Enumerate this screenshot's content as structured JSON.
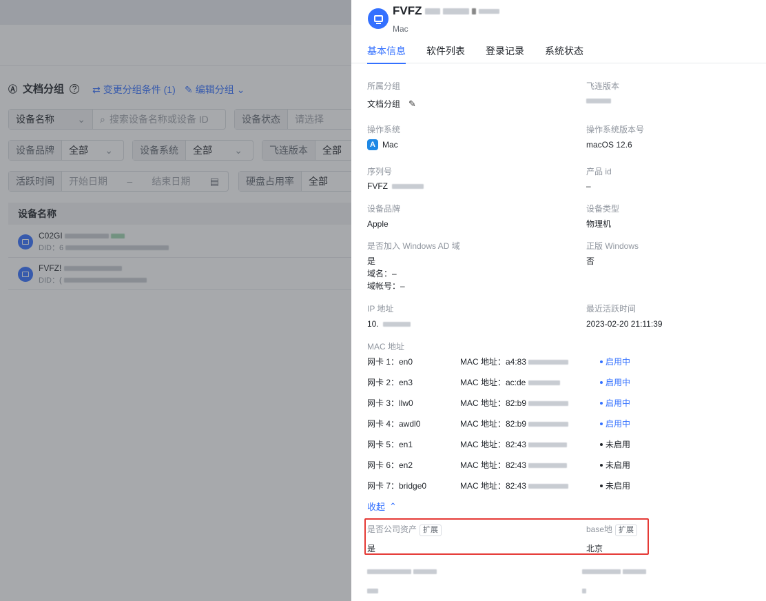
{
  "background": {
    "group": {
      "title": "文档分组",
      "change_condition": "变更分组条件 (1)",
      "edit_group": "编辑分组"
    },
    "filters": {
      "device_name_label": "设备名称",
      "search_placeholder": "搜索设备名称或设备 ID",
      "device_status_label": "设备状态",
      "device_status_placeholder": "请选择",
      "device_brand_label": "设备品牌",
      "device_brand_value": "全部",
      "device_system_label": "设备系统",
      "device_system_value": "全部",
      "feilian_version_label": "飞连版本",
      "feilian_version_value": "全部",
      "active_time_label": "活跃时间",
      "start_date_placeholder": "开始日期",
      "date_separator": "–",
      "end_date_placeholder": "结束日期",
      "disk_usage_label": "硬盘占用率",
      "disk_usage_value": "全部"
    },
    "table": {
      "header": "设备名称",
      "rows": [
        {
          "name": "C02GI",
          "did": "DID：6"
        },
        {
          "name": "FVFZ!",
          "did": "DID：("
        }
      ]
    }
  },
  "drawer": {
    "title": "FVFZ",
    "subtitle": "Mac",
    "tabs": [
      "基本信息",
      "软件列表",
      "登录记录",
      "系统状态"
    ],
    "fields": {
      "group_label": "所属分组",
      "group_value": "文档分组",
      "version_label": "飞连版本",
      "os_label": "操作系统",
      "os_value": "Mac",
      "os_version_label": "操作系统版本号",
      "os_version_value": "macOS 12.6",
      "serial_label": "序列号",
      "serial_value": "FVFZ",
      "product_id_label": "产品 id",
      "product_id_value": "–",
      "brand_label": "设备品牌",
      "brand_value": "Apple",
      "type_label": "设备类型",
      "type_value": "物理机",
      "ad_label": "是否加入 Windows AD 域",
      "ad_value": "是",
      "ad_domain": "域名：–",
      "ad_account": "域帐号：–",
      "genuine_label": "正版 Windows",
      "genuine_value": "否",
      "ip_label": "IP 地址",
      "ip_value": "10.",
      "last_active_label": "最近活跃时间",
      "last_active_value": "2023-02-20 21:11:39",
      "mac_label": "MAC 地址"
    },
    "nics": [
      {
        "name": "网卡 1：en0",
        "mac": "MAC 地址：a4:83",
        "status": "启用中",
        "on": true
      },
      {
        "name": "网卡 2：en3",
        "mac": "MAC 地址：ac:de",
        "status": "启用中",
        "on": true
      },
      {
        "name": "网卡 3：llw0",
        "mac": "MAC 地址：82:b9",
        "status": "启用中",
        "on": true
      },
      {
        "name": "网卡 4：awdl0",
        "mac": "MAC 地址：82:b9",
        "status": "启用中",
        "on": true
      },
      {
        "name": "网卡 5：en1",
        "mac": "MAC 地址：82:43",
        "status": "未启用",
        "on": false
      },
      {
        "name": "网卡 6：en2",
        "mac": "MAC 地址：82:43",
        "status": "未启用",
        "on": false
      },
      {
        "name": "网卡 7：bridge0",
        "mac": "MAC 地址：82:43",
        "status": "未启用",
        "on": false
      }
    ],
    "collapse_label": "收起",
    "extended": {
      "company_asset_label": "是否公司资产",
      "company_asset_value": "是",
      "base_label": "base地",
      "base_value": "北京",
      "tag": "扩展"
    },
    "colors": {
      "accent": "#3370ff",
      "highlight": "#e53935"
    }
  }
}
